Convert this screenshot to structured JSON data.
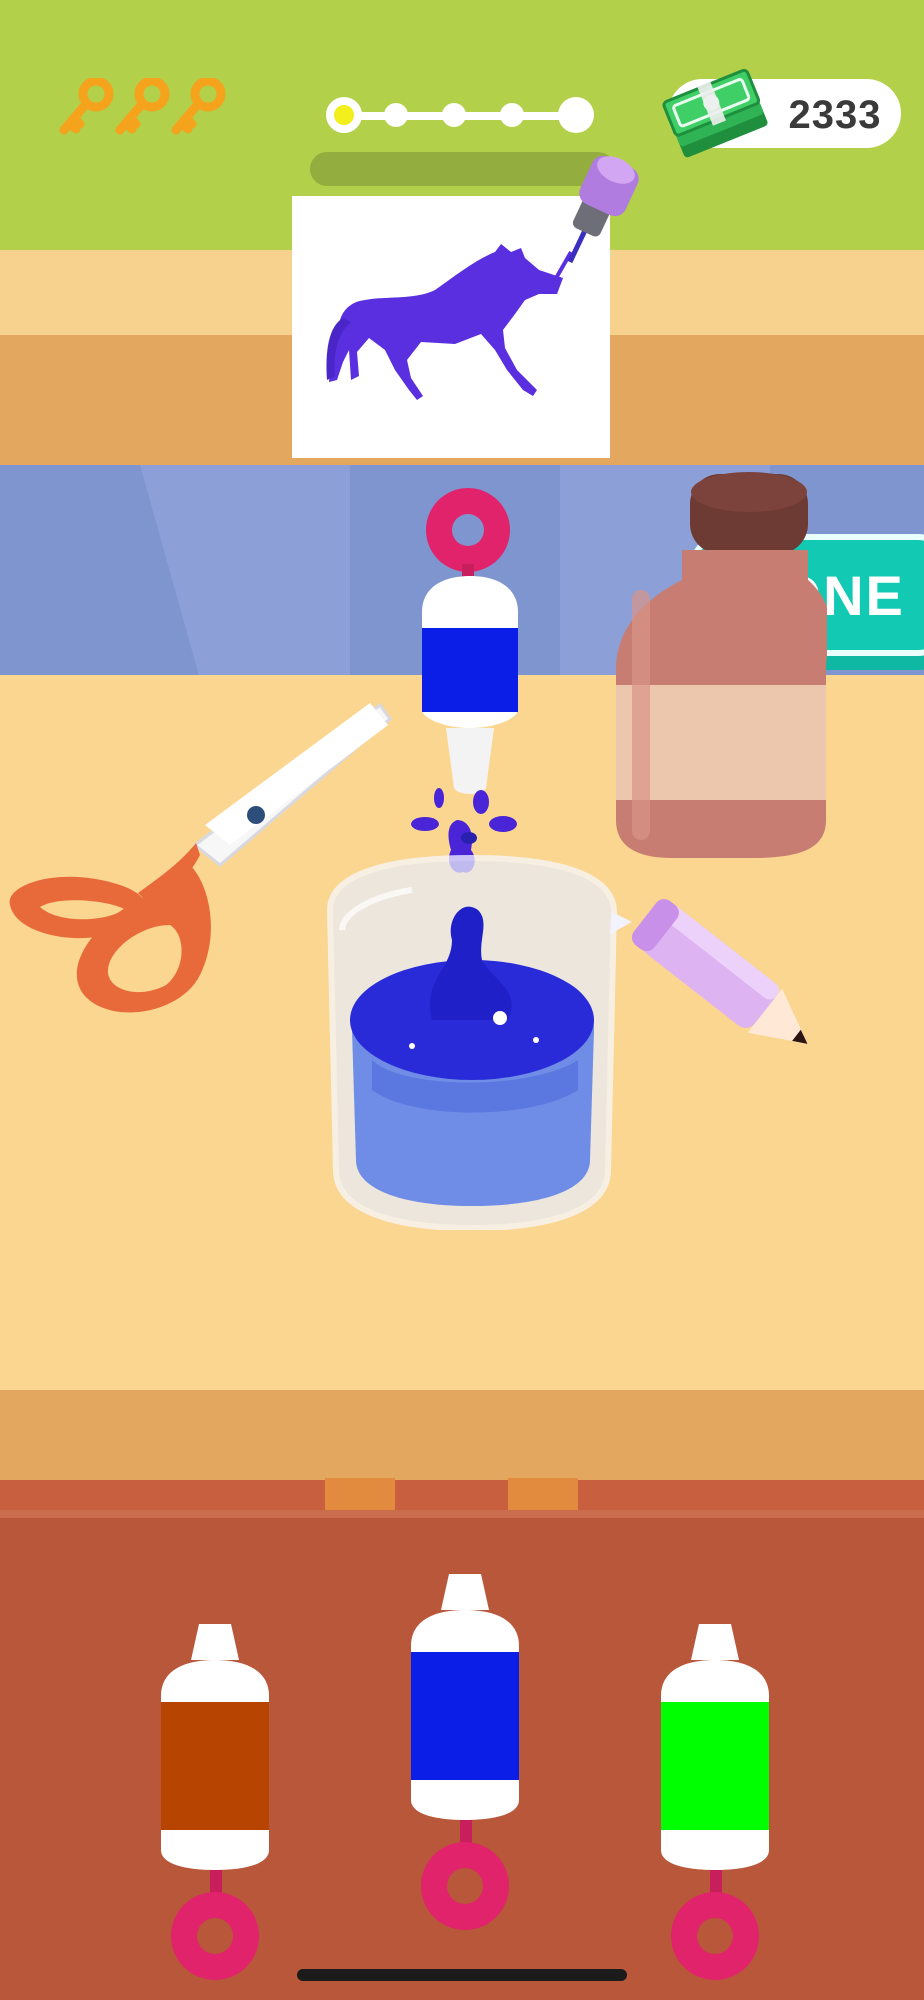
{
  "hud": {
    "keys_count": 3,
    "key_icon": "key-icon",
    "level_progress": {
      "total_steps": 5,
      "current_step": 1
    },
    "cash_value": "2333",
    "cash_icon": "cash-stack-icon",
    "fill_progress": 0.0
  },
  "drawing": {
    "subject": "unicorn",
    "color": "#5a2fe0"
  },
  "actions": {
    "done_label": "DONE"
  },
  "colors": {
    "grass": "#b3d04a",
    "done_button": "#12cab3",
    "tray": "#b9573a",
    "liquid": "#3b3bd6"
  },
  "dye_bottles": [
    {
      "name": "brown",
      "color": "#b74400",
      "selected": false
    },
    {
      "name": "blue",
      "color": "#0a1ee8",
      "selected": true
    },
    {
      "name": "green",
      "color": "#00ff00",
      "selected": false
    }
  ]
}
